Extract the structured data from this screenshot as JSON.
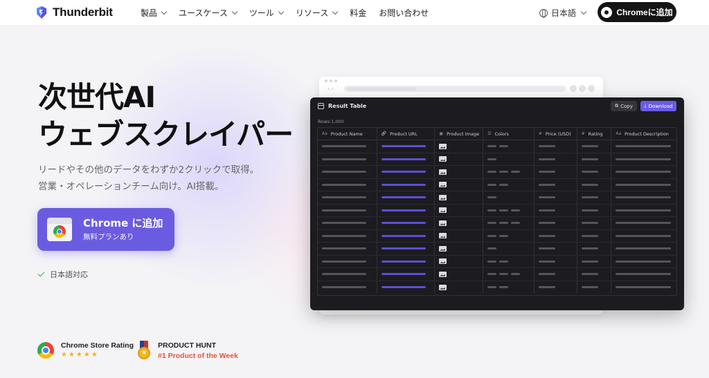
{
  "nav": {
    "brand": "Thunderbit",
    "menu": [
      {
        "label": "製品",
        "dropdown": true
      },
      {
        "label": "ユースケース",
        "dropdown": true
      },
      {
        "label": "ツール",
        "dropdown": true
      },
      {
        "label": "リソース",
        "dropdown": true
      },
      {
        "label": "料金",
        "dropdown": false
      },
      {
        "label": "お問い合わせ",
        "dropdown": false
      }
    ],
    "language": "日本語",
    "cta": "Chromeに追加"
  },
  "hero": {
    "title_line1": "次世代AI",
    "title_line2": "ウェブスクレイパー",
    "sub_line1": "リードやその他のデータをわずか2クリックで取得。",
    "sub_line2": "営業・オペレーションチーム向け。AI搭載。",
    "cta_main": "Chrome に追加",
    "cta_note": "無料プランあり",
    "support_note": "日本語対応"
  },
  "badges": {
    "chrome_rating_title": "Chrome Store Rating",
    "chrome_rating_stars": "★★★★★",
    "ph_title": "PRODUCT HUNT",
    "ph_subtitle": "#1 Product of the Week"
  },
  "app": {
    "title": "Result Table",
    "copy_label": "Copy",
    "download_label": "Download",
    "rows_label": "Rows:1,000",
    "columns": [
      {
        "icon": "Aa",
        "label": "Product Name"
      },
      {
        "icon": "🔗",
        "label": "Product URL"
      },
      {
        "icon": "▣",
        "label": "Product Image"
      },
      {
        "icon": "☰",
        "label": "Colors"
      },
      {
        "icon": "#",
        "label": "Price (USD)"
      },
      {
        "icon": "#",
        "label": "Rating"
      },
      {
        "icon": "Aa",
        "label": "Product Description"
      }
    ],
    "row_count": 12,
    "accent": "#6b5ce6"
  },
  "colors": {
    "brand": "#6a5ce0",
    "dark": "#141414",
    "star": "#f3b31a",
    "ph_red": "#e8533a"
  }
}
